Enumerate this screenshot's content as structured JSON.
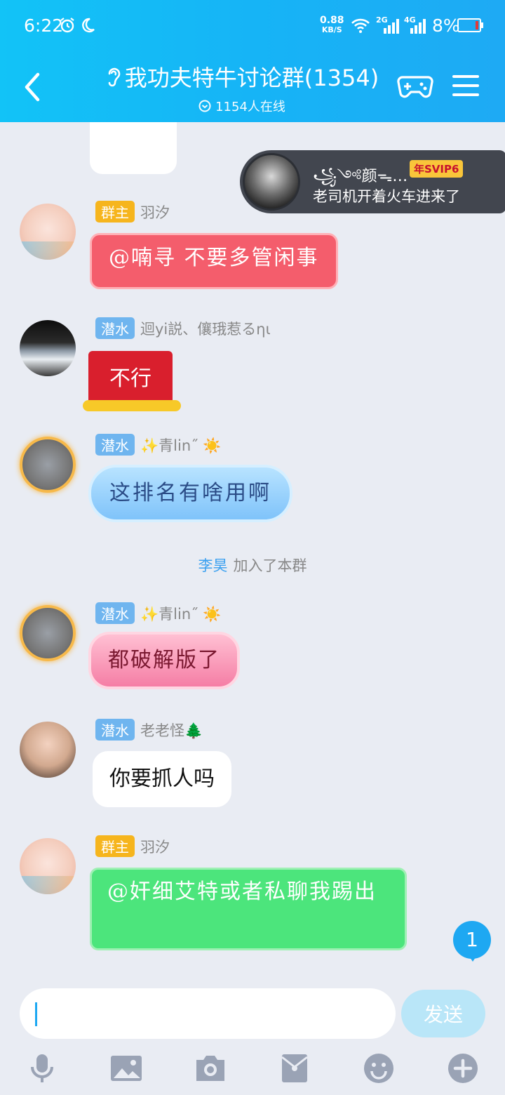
{
  "status_bar": {
    "time": "6:22",
    "net_speed_value": "0.88",
    "net_speed_unit": "KB/S",
    "signal_2g": "2G",
    "signal_4g": "4G",
    "battery": "8%"
  },
  "header": {
    "title": "我功夫特牛讨论群(1354)",
    "online": "1154人在线"
  },
  "join_banner": {
    "name": "꧁༺颜ᯓ…",
    "badge": "年SVIP6",
    "text": "老司机开着火车进来了"
  },
  "messages": [
    {
      "badge": "群主",
      "name": "羽汐",
      "text": "@喃寻 不要多管闲事"
    },
    {
      "badge": "潜水",
      "name": "迴yi説、儴珴惹るηι",
      "text": "不行"
    },
    {
      "badge": "潜水",
      "name": "✨青lin˝ ☀️",
      "text": "这排名有啥用啊"
    },
    {
      "badge": "潜水",
      "name": "✨青lin˝ ☀️",
      "text": "都破解版了"
    },
    {
      "badge": "潜水",
      "name": "老老怪🌲",
      "text": "你要抓人吗"
    },
    {
      "badge": "群主",
      "name": "羽汐",
      "text": "@奸细艾特或者私聊我踢出"
    }
  ],
  "system_message": {
    "who": "李昊",
    "text": "加入了本群"
  },
  "unread_count": "1",
  "input": {
    "value": "",
    "placeholder": ""
  },
  "send_label": "发送",
  "colors": {
    "header": "#16b4f6",
    "background": "#e9ecf3",
    "accent": "#1ea8f2"
  }
}
